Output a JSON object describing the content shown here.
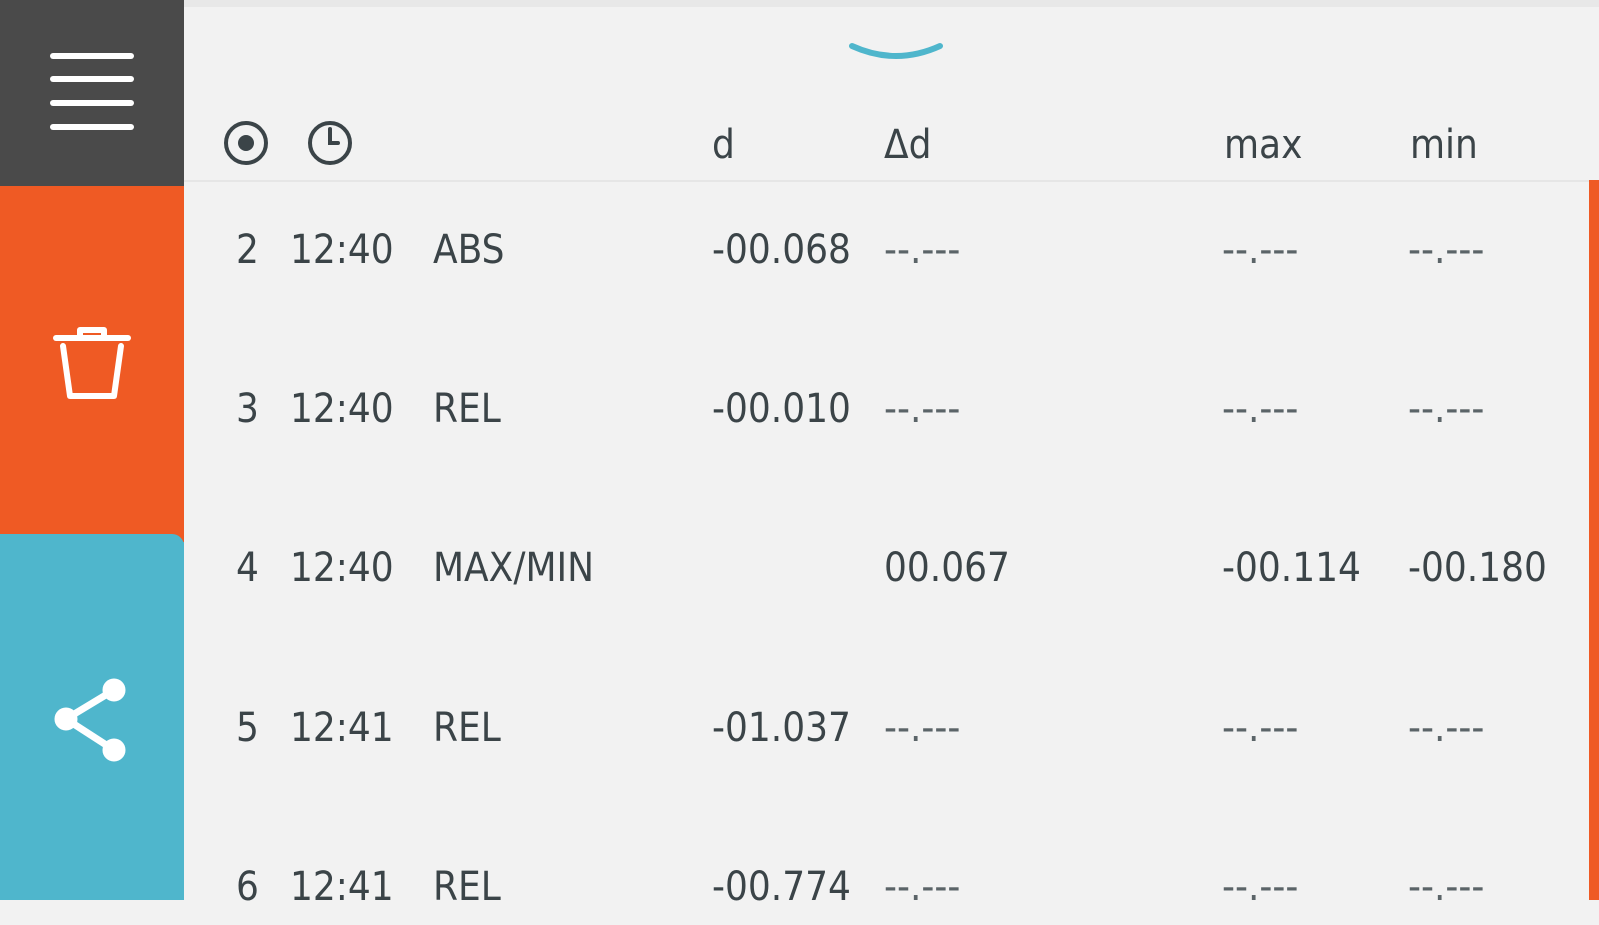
{
  "sidebar": {
    "menu_icon": "hamburger-menu-icon",
    "delete_icon": "trash-icon",
    "share_icon": "share-icon",
    "colors": {
      "menu": "#4a4a4a",
      "delete": "#ef5a24",
      "share": "#4fb6cc"
    }
  },
  "header": {
    "point_icon": "radio-target-icon",
    "time_icon": "clock-icon",
    "col_d": "d",
    "col_delta_d": "Δd",
    "col_max": "max",
    "col_min": "min"
  },
  "rows": [
    {
      "num": "2",
      "time": "12:40",
      "type": "ABS",
      "d": "-00.068",
      "dd": "--.---",
      "max": "--.---",
      "min": "--.---"
    },
    {
      "num": "3",
      "time": "12:40",
      "type": "REL",
      "d": "-00.010",
      "dd": "--.---",
      "max": "--.---",
      "min": "--.---"
    },
    {
      "num": "4",
      "time": "12:40",
      "type": "MAX/MIN",
      "d": "",
      "dd": "00.067",
      "max": "-00.114",
      "min": "-00.180"
    },
    {
      "num": "5",
      "time": "12:41",
      "type": "REL",
      "d": "-01.037",
      "dd": "--.---",
      "max": "--.---",
      "min": "--.---"
    },
    {
      "num": "6",
      "time": "12:41",
      "type": "REL",
      "d": "-00.774",
      "dd": "--.---",
      "max": "--.---",
      "min": "--.---"
    }
  ]
}
